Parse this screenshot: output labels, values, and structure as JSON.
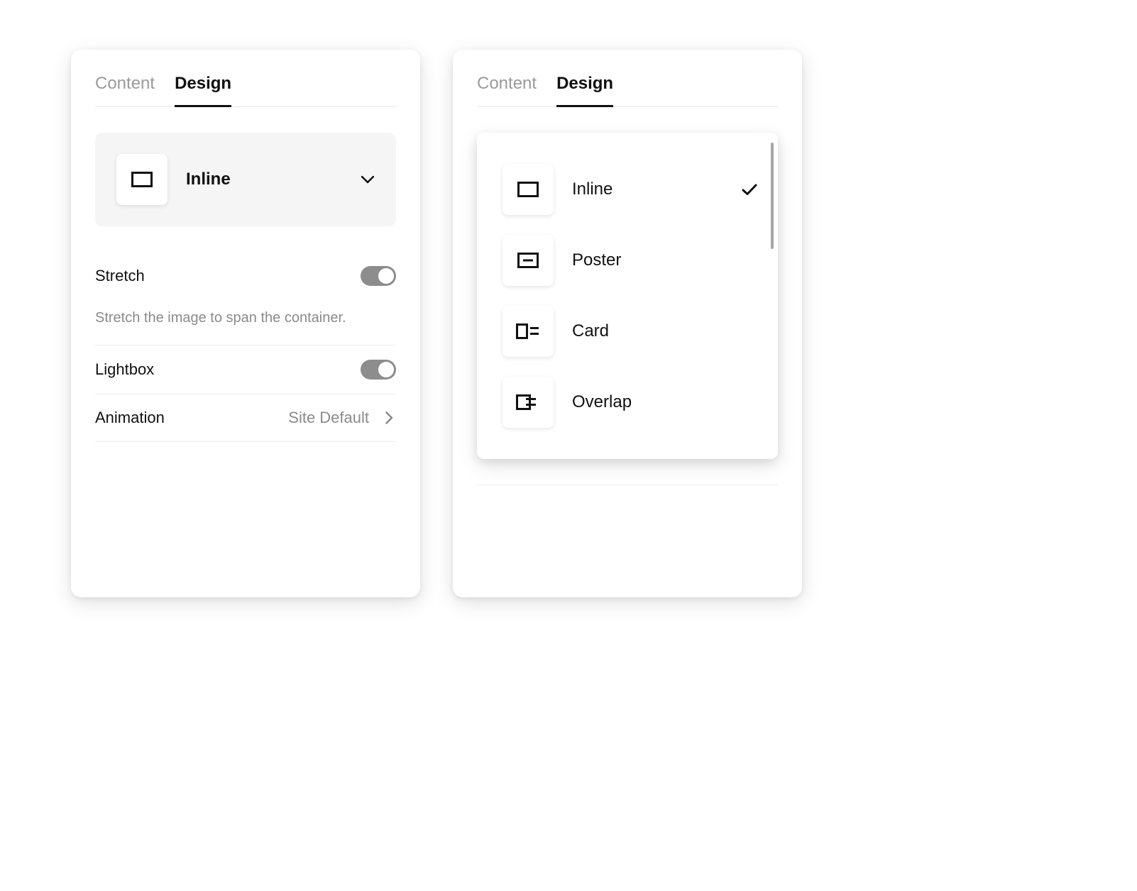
{
  "tabs": {
    "content": "Content",
    "design": "Design"
  },
  "left_panel": {
    "layout_selected": "Inline",
    "stretch": {
      "label": "Stretch",
      "description": "Stretch the image to span the container.",
      "enabled": true
    },
    "lightbox": {
      "label": "Lightbox",
      "enabled": true
    },
    "animation": {
      "label": "Animation",
      "value": "Site Default"
    }
  },
  "right_panel": {
    "options": [
      {
        "label": "Inline",
        "selected": true
      },
      {
        "label": "Poster",
        "selected": false
      },
      {
        "label": "Card",
        "selected": false
      },
      {
        "label": "Overlap",
        "selected": false
      }
    ]
  }
}
